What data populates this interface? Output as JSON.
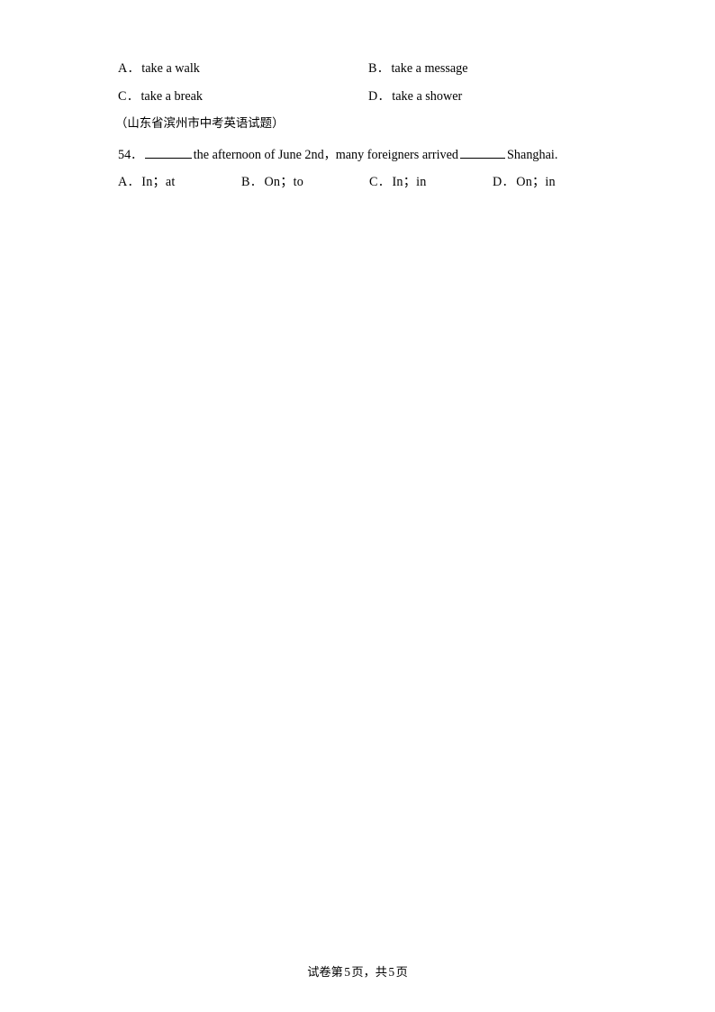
{
  "document": {
    "type": "exam-paper-page",
    "page_background": "#ffffff",
    "text_color": "#000000"
  },
  "previous_question_options": {
    "row1": [
      {
        "letter": "A",
        "separator": "．",
        "text": "take a walk"
      },
      {
        "letter": "B",
        "separator": "．",
        "text": "take a message"
      }
    ],
    "row2": [
      {
        "letter": "C",
        "separator": "．",
        "text": "take a break"
      },
      {
        "letter": "D",
        "separator": "．",
        "text": "take a shower"
      }
    ]
  },
  "source_note": "（山东省滨州市中考英语试题）",
  "question_54": {
    "number": "54",
    "number_separator": "．",
    "stem_part_1": "the afternoon of June 2nd",
    "stem_comma": "，",
    "stem_part_2": "many foreigners arrived",
    "stem_part_3": "Shanghai.",
    "blank_1_label": "blank",
    "blank_2_label": "blank",
    "options": [
      {
        "letter": "A",
        "separator": "．",
        "text": "In；at"
      },
      {
        "letter": "B",
        "separator": "．",
        "text": "On；to"
      },
      {
        "letter": "C",
        "separator": "．",
        "text": "In；in"
      },
      {
        "letter": "D",
        "separator": "．",
        "text": "On；in"
      }
    ]
  },
  "footer": {
    "prefix": "试卷第",
    "current_page": "5",
    "middle": "页，共",
    "total_pages": "5",
    "suffix": "页"
  }
}
